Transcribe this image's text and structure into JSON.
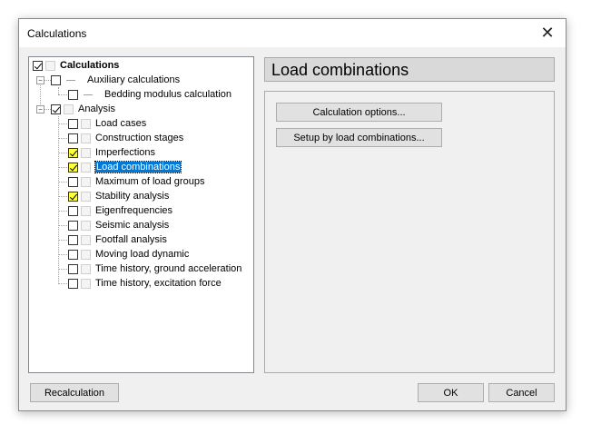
{
  "window": {
    "title": "Calculations",
    "close_glyph": "✕"
  },
  "tree": {
    "items": [
      {
        "label": "Calculations",
        "checked": true,
        "yellow": false,
        "bold": true
      },
      {
        "label": "Auxiliary calculations",
        "checked": false,
        "yellow": false
      },
      {
        "label": "Bedding modulus calculation",
        "checked": false,
        "yellow": false
      },
      {
        "label": "Analysis",
        "checked": true,
        "yellow": false
      },
      {
        "label": "Load cases",
        "checked": false,
        "yellow": false
      },
      {
        "label": "Construction stages",
        "checked": false,
        "yellow": false
      },
      {
        "label": "Imperfections",
        "checked": true,
        "yellow": true
      },
      {
        "label": "Load combinations",
        "checked": true,
        "yellow": true,
        "selected": true
      },
      {
        "label": "Maximum of load groups",
        "checked": false,
        "yellow": false
      },
      {
        "label": "Stability analysis",
        "checked": true,
        "yellow": true
      },
      {
        "label": "Eigenfrequencies",
        "checked": false,
        "yellow": false
      },
      {
        "label": "Seismic analysis",
        "checked": false,
        "yellow": false
      },
      {
        "label": "Footfall analysis",
        "checked": false,
        "yellow": false
      },
      {
        "label": "Moving load dynamic",
        "checked": false,
        "yellow": false
      },
      {
        "label": "Time history, ground acceleration",
        "checked": false,
        "yellow": false
      },
      {
        "label": "Time history, excitation force",
        "checked": false,
        "yellow": false
      }
    ]
  },
  "panel": {
    "title": "Load combinations",
    "calc_options_label": "Calculation options...",
    "setup_label": "Setup by load combinations..."
  },
  "footer": {
    "recalc_label": "Recalculation",
    "ok_label": "OK",
    "cancel_label": "Cancel"
  },
  "colors": {
    "selection": "#0078d7",
    "check_highlight": "#ffff3c"
  }
}
